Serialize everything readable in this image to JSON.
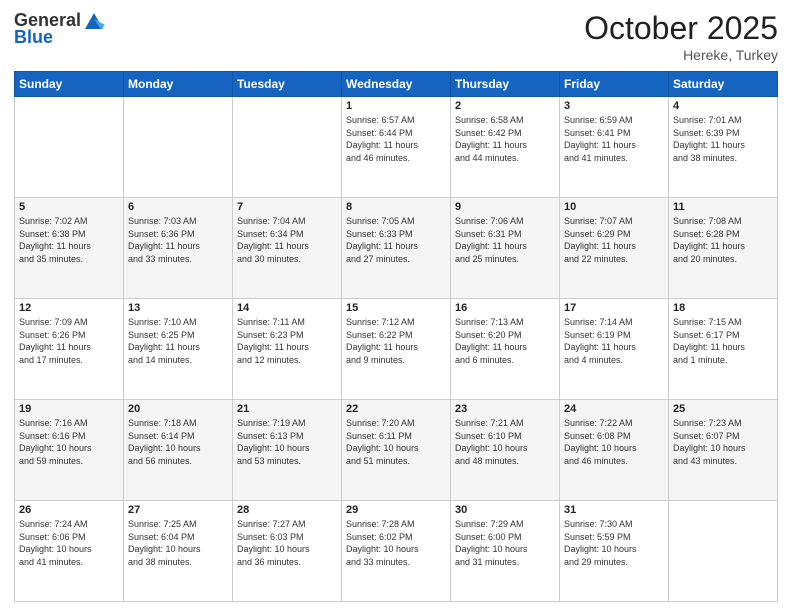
{
  "header": {
    "logo_general": "General",
    "logo_blue": "Blue",
    "month_title": "October 2025",
    "location": "Hereke, Turkey"
  },
  "weekdays": [
    "Sunday",
    "Monday",
    "Tuesday",
    "Wednesday",
    "Thursday",
    "Friday",
    "Saturday"
  ],
  "weeks": [
    [
      {
        "day": "",
        "info": ""
      },
      {
        "day": "",
        "info": ""
      },
      {
        "day": "",
        "info": ""
      },
      {
        "day": "1",
        "info": "Sunrise: 6:57 AM\nSunset: 6:44 PM\nDaylight: 11 hours\nand 46 minutes."
      },
      {
        "day": "2",
        "info": "Sunrise: 6:58 AM\nSunset: 6:42 PM\nDaylight: 11 hours\nand 44 minutes."
      },
      {
        "day": "3",
        "info": "Sunrise: 6:59 AM\nSunset: 6:41 PM\nDaylight: 11 hours\nand 41 minutes."
      },
      {
        "day": "4",
        "info": "Sunrise: 7:01 AM\nSunset: 6:39 PM\nDaylight: 11 hours\nand 38 minutes."
      }
    ],
    [
      {
        "day": "5",
        "info": "Sunrise: 7:02 AM\nSunset: 6:38 PM\nDaylight: 11 hours\nand 35 minutes."
      },
      {
        "day": "6",
        "info": "Sunrise: 7:03 AM\nSunset: 6:36 PM\nDaylight: 11 hours\nand 33 minutes."
      },
      {
        "day": "7",
        "info": "Sunrise: 7:04 AM\nSunset: 6:34 PM\nDaylight: 11 hours\nand 30 minutes."
      },
      {
        "day": "8",
        "info": "Sunrise: 7:05 AM\nSunset: 6:33 PM\nDaylight: 11 hours\nand 27 minutes."
      },
      {
        "day": "9",
        "info": "Sunrise: 7:06 AM\nSunset: 6:31 PM\nDaylight: 11 hours\nand 25 minutes."
      },
      {
        "day": "10",
        "info": "Sunrise: 7:07 AM\nSunset: 6:29 PM\nDaylight: 11 hours\nand 22 minutes."
      },
      {
        "day": "11",
        "info": "Sunrise: 7:08 AM\nSunset: 6:28 PM\nDaylight: 11 hours\nand 20 minutes."
      }
    ],
    [
      {
        "day": "12",
        "info": "Sunrise: 7:09 AM\nSunset: 6:26 PM\nDaylight: 11 hours\nand 17 minutes."
      },
      {
        "day": "13",
        "info": "Sunrise: 7:10 AM\nSunset: 6:25 PM\nDaylight: 11 hours\nand 14 minutes."
      },
      {
        "day": "14",
        "info": "Sunrise: 7:11 AM\nSunset: 6:23 PM\nDaylight: 11 hours\nand 12 minutes."
      },
      {
        "day": "15",
        "info": "Sunrise: 7:12 AM\nSunset: 6:22 PM\nDaylight: 11 hours\nand 9 minutes."
      },
      {
        "day": "16",
        "info": "Sunrise: 7:13 AM\nSunset: 6:20 PM\nDaylight: 11 hours\nand 6 minutes."
      },
      {
        "day": "17",
        "info": "Sunrise: 7:14 AM\nSunset: 6:19 PM\nDaylight: 11 hours\nand 4 minutes."
      },
      {
        "day": "18",
        "info": "Sunrise: 7:15 AM\nSunset: 6:17 PM\nDaylight: 11 hours\nand 1 minute."
      }
    ],
    [
      {
        "day": "19",
        "info": "Sunrise: 7:16 AM\nSunset: 6:16 PM\nDaylight: 10 hours\nand 59 minutes."
      },
      {
        "day": "20",
        "info": "Sunrise: 7:18 AM\nSunset: 6:14 PM\nDaylight: 10 hours\nand 56 minutes."
      },
      {
        "day": "21",
        "info": "Sunrise: 7:19 AM\nSunset: 6:13 PM\nDaylight: 10 hours\nand 53 minutes."
      },
      {
        "day": "22",
        "info": "Sunrise: 7:20 AM\nSunset: 6:11 PM\nDaylight: 10 hours\nand 51 minutes."
      },
      {
        "day": "23",
        "info": "Sunrise: 7:21 AM\nSunset: 6:10 PM\nDaylight: 10 hours\nand 48 minutes."
      },
      {
        "day": "24",
        "info": "Sunrise: 7:22 AM\nSunset: 6:08 PM\nDaylight: 10 hours\nand 46 minutes."
      },
      {
        "day": "25",
        "info": "Sunrise: 7:23 AM\nSunset: 6:07 PM\nDaylight: 10 hours\nand 43 minutes."
      }
    ],
    [
      {
        "day": "26",
        "info": "Sunrise: 7:24 AM\nSunset: 6:06 PM\nDaylight: 10 hours\nand 41 minutes."
      },
      {
        "day": "27",
        "info": "Sunrise: 7:25 AM\nSunset: 6:04 PM\nDaylight: 10 hours\nand 38 minutes."
      },
      {
        "day": "28",
        "info": "Sunrise: 7:27 AM\nSunset: 6:03 PM\nDaylight: 10 hours\nand 36 minutes."
      },
      {
        "day": "29",
        "info": "Sunrise: 7:28 AM\nSunset: 6:02 PM\nDaylight: 10 hours\nand 33 minutes."
      },
      {
        "day": "30",
        "info": "Sunrise: 7:29 AM\nSunset: 6:00 PM\nDaylight: 10 hours\nand 31 minutes."
      },
      {
        "day": "31",
        "info": "Sunrise: 7:30 AM\nSunset: 5:59 PM\nDaylight: 10 hours\nand 29 minutes."
      },
      {
        "day": "",
        "info": ""
      }
    ]
  ]
}
